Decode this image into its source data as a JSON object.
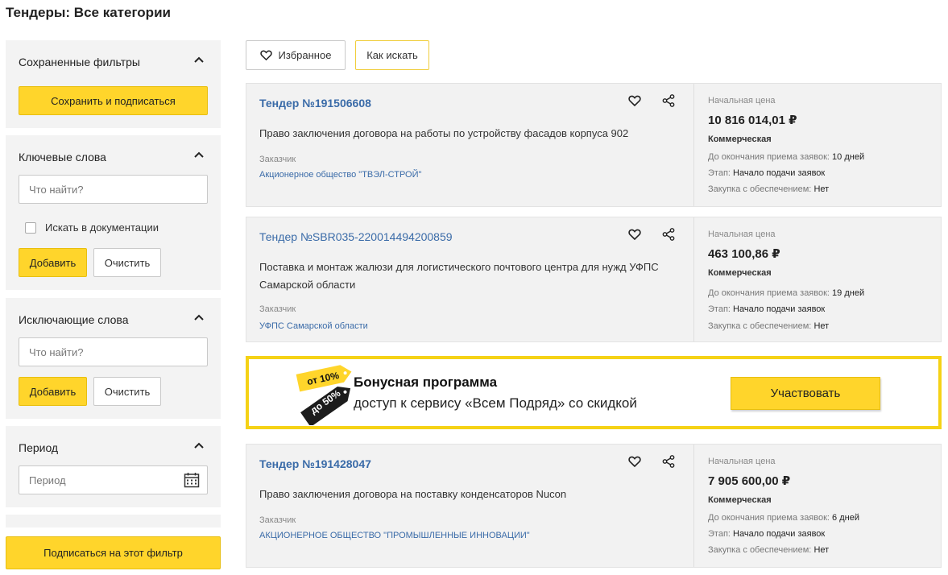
{
  "page": {
    "title": "Тендеры: Все категории"
  },
  "sidebar": {
    "saved_filters": {
      "title": "Сохраненные фильтры",
      "button": "Сохранить и подписаться"
    },
    "keywords": {
      "title": "Ключевые слова",
      "placeholder": "Что найти?",
      "checkbox_label": "Искать в документации",
      "add": "Добавить",
      "clear": "Очистить"
    },
    "exclude": {
      "title": "Исключающие слова",
      "placeholder": "Что найти?",
      "add": "Добавить",
      "clear": "Очистить"
    },
    "period": {
      "title": "Период",
      "placeholder": "Период"
    },
    "subscribe": "Подписаться на этот фильтр"
  },
  "toolbar": {
    "favorites": "Избранное",
    "how_to_search": "Как искать"
  },
  "labels": {
    "customer": "Заказчик",
    "start_price": "Начальная цена",
    "deadline": "До окончания приема заявок:",
    "stage": "Этап:",
    "security": "Закупка с обеспечением:"
  },
  "tenders": [
    {
      "number": "Тендер №191506608",
      "description": "Право заключения договора на работы по устройству фасадов корпуса 902",
      "customer": "Акционерное общество \"ТВЭЛ-СТРОЙ\"",
      "price": "10 816 014,01 ₽",
      "type": "Коммерческая",
      "deadline": "10 дней",
      "stage": "Начало подачи заявок",
      "security": "Нет"
    },
    {
      "number": "Тендер №SBR035-220014494200859",
      "description": "Поставка и монтаж жалюзи для логистического почтового центра для нужд УФПС Самарской области",
      "customer": "УФПС Самарской области",
      "price": "463 100,86 ₽",
      "type": "Коммерческая",
      "deadline": "19 дней",
      "stage": "Начало подачи заявок",
      "security": "Нет"
    },
    {
      "number": "Тендер №191428047",
      "description": "Право заключения договора на поставку конденсаторов Nucon",
      "customer": "АКЦИОНЕРНОЕ ОБЩЕСТВО \"ПРОМЫШЛЕННЫЕ ИННОВАЦИИ\"",
      "price": "7 905 600,00 ₽",
      "type": "Коммерческая",
      "deadline": "6 дней",
      "stage": "Начало подачи заявок",
      "security": "Нет"
    }
  ],
  "banner": {
    "tag_from": "от 10%",
    "tag_to": "до 50%",
    "title": "Бонусная программа",
    "subtitle": "доступ к сервису «Всем Подряд» со скидкой",
    "button": "Участвовать"
  },
  "colors": {
    "accent": "#ffd52b",
    "link": "#3a6ba8",
    "panel": "#f3f3f3"
  }
}
